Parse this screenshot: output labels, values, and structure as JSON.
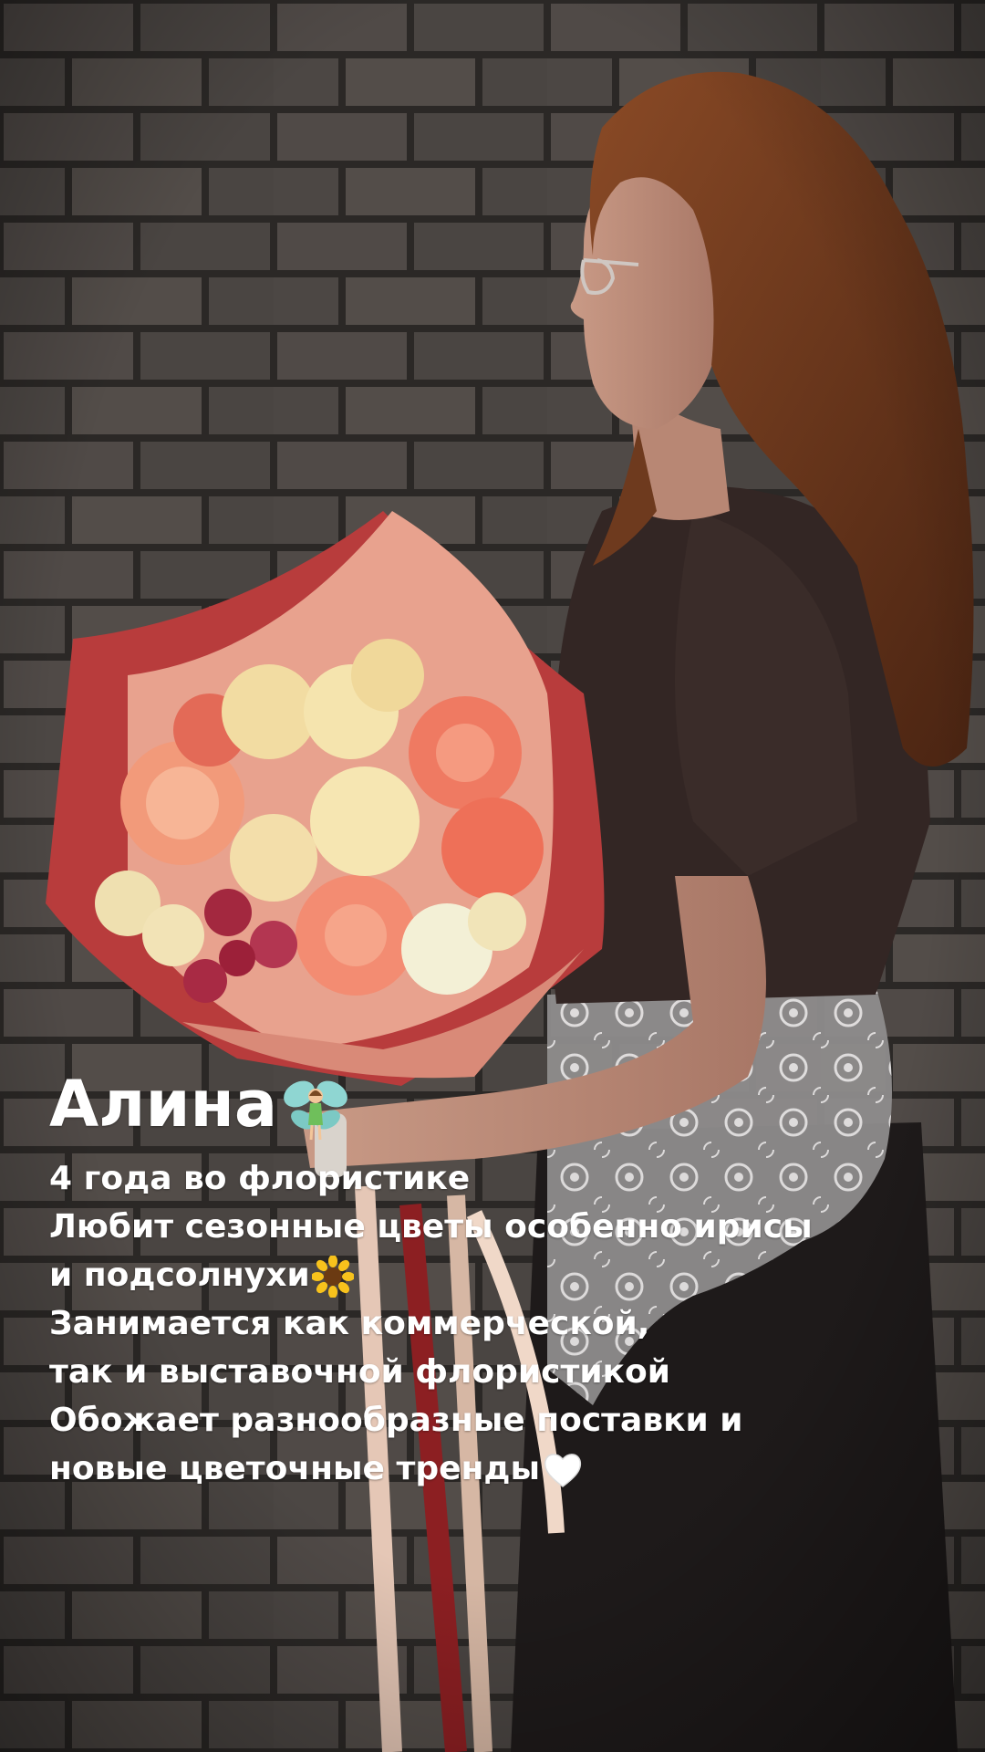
{
  "story": {
    "name": "Алина",
    "name_emoji": "fairy-emoji",
    "lines": [
      "4 года во флористике",
      "Любит сезонные цветы особенно ирисы",
      "и подсолнухи",
      "Занимается как коммерческой,",
      "так и выставочной флористикой",
      "Обожает разнообразные  поставки и",
      "новые цветочные тренды"
    ],
    "line_emojis": {
      "2": "sunflower-emoji",
      "6": "white-heart-emoji"
    }
  },
  "colors": {
    "brick_wall": "#4a4542",
    "mortar": "#2a2725",
    "wrap_red": "#b83c3c",
    "wrap_pink": "#e8a28e",
    "text": "#ffffff"
  }
}
